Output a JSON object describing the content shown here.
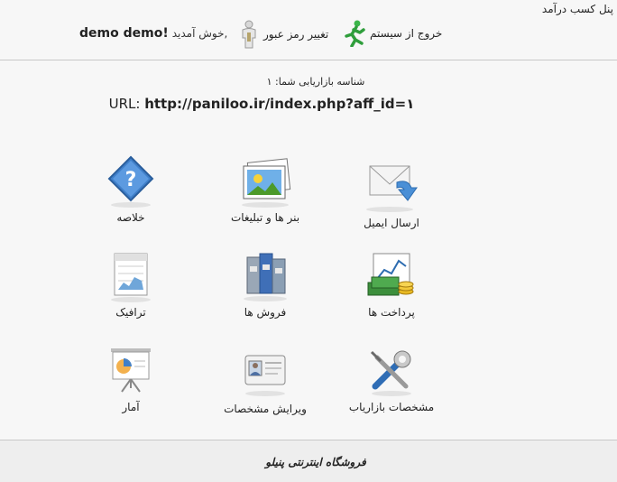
{
  "header": {
    "panel_title": "پنل کسب درآمد",
    "logout_label": "خروج از سیستم",
    "change_password_label": "تغییر رمز عبور",
    "welcome_label": "خوش آمدید,",
    "user_name": "demo demo!"
  },
  "info": {
    "tracking_id_label": "شناسه بازاریابی شما: ۱",
    "url_prefix": "URL:",
    "url_value": "http://paniloo.ir/index.php?aff_id=۱"
  },
  "tiles": [
    {
      "label": "ارسال ایمیل",
      "icon": "email-icon"
    },
    {
      "label": "بنر ها و تبلیغات",
      "icon": "banners-icon"
    },
    {
      "label": "خلاصه",
      "icon": "help-icon"
    },
    {
      "label": "پرداخت ها",
      "icon": "payments-icon"
    },
    {
      "label": "فروش ها",
      "icon": "sales-icon"
    },
    {
      "label": "ترافیک",
      "icon": "traffic-icon"
    },
    {
      "label": "مشخصات بازاریاب",
      "icon": "tools-icon"
    },
    {
      "label": "ویرایش مشخصات",
      "icon": "id-card-icon"
    },
    {
      "label": "آمار",
      "icon": "presentation-icon"
    }
  ],
  "footer": {
    "text": "فروشگاه اینترنتی پنیلو"
  }
}
